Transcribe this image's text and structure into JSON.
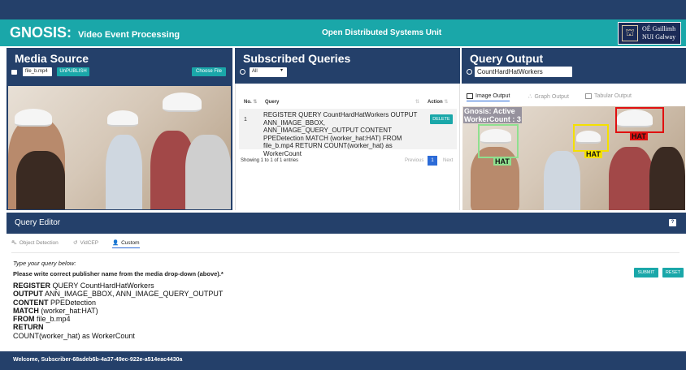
{
  "header": {
    "brand": "GNOSIS:",
    "brand_sub": "Video Event Processing",
    "center_title": "Open Distributed Systems Unit",
    "logo_line1": "OÉ Gaillimh",
    "logo_line2": "NUI Galway"
  },
  "media_source": {
    "title": "Media Source",
    "file_value": "file_b.mp4",
    "unpublish_label": "UnPUBLISH",
    "choose_file_label": "Choose File"
  },
  "subscribed_queries": {
    "title": "Subscribed Queries",
    "filter_value": "All",
    "columns": [
      "No.",
      "Query",
      "Action"
    ],
    "rows": [
      {
        "no": "1",
        "query": "REGISTER QUERY CountHardHatWorkers OUTPUT ANN_IMAGE_BBOX, ANN_IMAGE_QUERY_OUTPUT CONTENT PPEDetection MATCH (worker_hat:HAT) FROM file_b.mp4 RETURN  COUNT(worker_hat) as WorkerCount",
        "action": "DELETE"
      }
    ],
    "entries_text": "Showing 1 to 1 of 1 entries",
    "prev": "Previous",
    "page": "1",
    "next": "Next"
  },
  "query_output": {
    "title": "Query Output",
    "query_name": "CountHardHatWorkers",
    "tabs": [
      "Image Output",
      "Graph Output",
      "Tabular Output"
    ],
    "overlay_line1": "Gnosis: Active",
    "overlay_line2": "WorkerCount : 3",
    "labels": [
      "HAT",
      "HAT",
      "HAT"
    ]
  },
  "editor": {
    "title": "Query Editor",
    "help": "?",
    "tabs": [
      "Object Detection",
      "VidCEP",
      "Custom"
    ],
    "hint1": "Type your query below:",
    "hint2": "Please write correct publisher name from the media drop-down (above).*",
    "submit": "SUBMIT",
    "reset": "RESET",
    "query": {
      "kw1": "REGISTER",
      "v1": " QUERY CountHardHatWorkers",
      "kw2": "OUTPUT",
      "v2": " ANN_IMAGE_BBOX, ANN_IMAGE_QUERY_OUTPUT",
      "kw3": "CONTENT",
      "v3": " PPEDetection",
      "kw4": "MATCH",
      "v4": " (worker_hat:HAT)",
      "kw5": "FROM",
      "v5": " file_b.mp4",
      "kw6": "RETURN",
      "v6": "COUNT(worker_hat) as WorkerCount"
    }
  },
  "footer": {
    "welcome": "Welcome, Subscriber-68adeb6b-4a37-49ec-922e-a514eac4430a"
  },
  "colors": {
    "navy": "#24406a",
    "teal": "#1aa7a9",
    "box_green": "#8fe08f",
    "box_yellow": "#f4e000",
    "box_red": "#e01010"
  }
}
